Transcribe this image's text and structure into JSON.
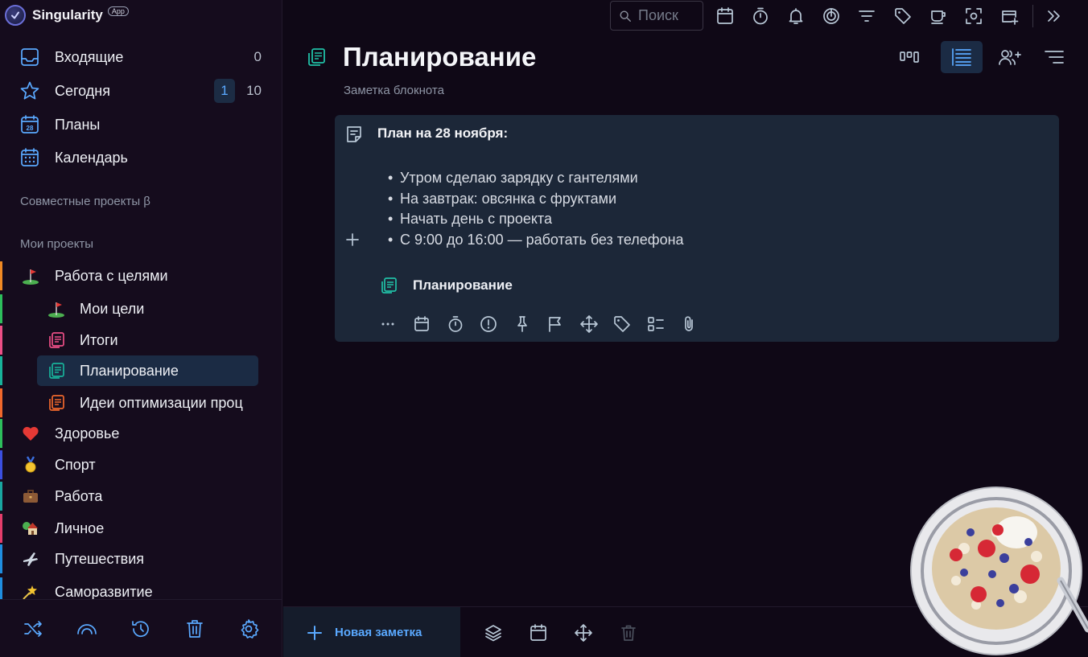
{
  "app": {
    "name": "Singularity",
    "badge": "App"
  },
  "search": {
    "placeholder": "Поиск"
  },
  "nav": {
    "inbox": {
      "label": "Входящие",
      "count": "0"
    },
    "today": {
      "label": "Сегодня",
      "badge": "1",
      "count": "10"
    },
    "plans": {
      "label": "Планы"
    },
    "calendar": {
      "label": "Календарь"
    }
  },
  "sections": {
    "shared": "Совместные проекты β",
    "mine": "Мои проекты"
  },
  "projects": [
    {
      "label": "Работа с целями",
      "color": "#f08a24"
    },
    {
      "label": "Мои цели",
      "color": "#2dbe5c"
    },
    {
      "label": "Итоги",
      "color": "#ec4f86"
    },
    {
      "label": "Планирование",
      "color": "#18b39a"
    },
    {
      "label": "Идеи оптимизации проц",
      "color": "#f0682c"
    },
    {
      "label": "Здоровье",
      "color": "#2dbe5c"
    },
    {
      "label": "Спорт",
      "color": "#3b4fe0"
    },
    {
      "label": "Работа",
      "color": "#19a6a0"
    },
    {
      "label": "Личное",
      "color": "#e53d6b"
    },
    {
      "label": "Путешествия",
      "color": "#1f8ee0"
    },
    {
      "label": "Саморазвитие",
      "color": "#1f8ee0"
    }
  ],
  "page": {
    "title": "Планирование",
    "subtitle": "Заметка блокнота"
  },
  "card": {
    "title": "План на 28 ноября:",
    "items": [
      "Утром сделаю зарядку с гантелями",
      "На завтрак: овсянка с фруктами",
      "Начать день с проекта",
      "С 9:00 до 16:00 — работать без телефона"
    ],
    "project_link": "Планирование"
  },
  "bottom": {
    "new_note": "Новая заметка"
  },
  "colors": {
    "accent": "#5aa9ff",
    "card_bg": "#1c2738",
    "page_bg": "#0f0816",
    "note_icon": "#20c0a6"
  }
}
